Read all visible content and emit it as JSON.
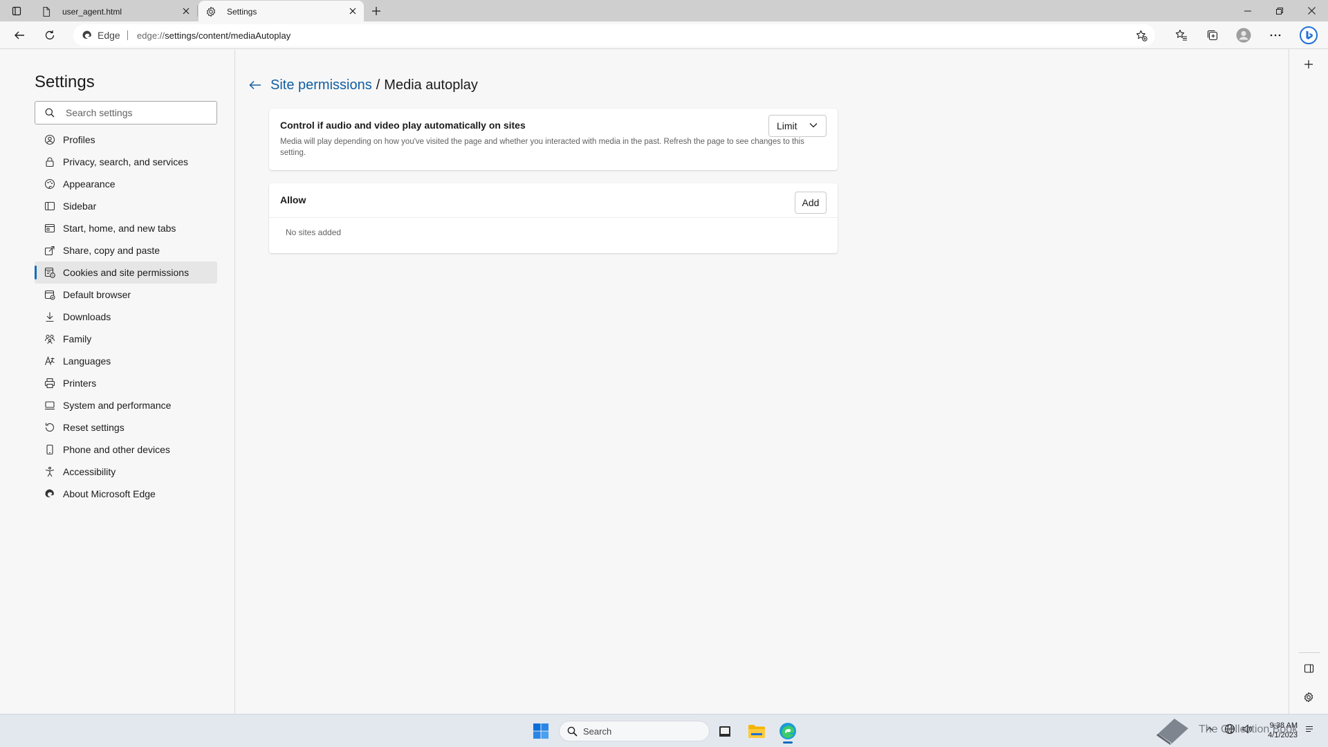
{
  "tabs": [
    {
      "title": "user_agent.html"
    },
    {
      "title": "Settings"
    }
  ],
  "address_bar": {
    "brand": "Edge",
    "url_prefix": "edge://",
    "url_path": "settings/content/mediaAutoplay"
  },
  "sidebar": {
    "title": "Settings",
    "search_placeholder": "Search settings",
    "items": [
      {
        "label": "Profiles",
        "icon": "profile-icon"
      },
      {
        "label": "Privacy, search, and services",
        "icon": "lock-icon"
      },
      {
        "label": "Appearance",
        "icon": "appearance-icon"
      },
      {
        "label": "Sidebar",
        "icon": "sidebar-icon"
      },
      {
        "label": "Start, home, and new tabs",
        "icon": "home-tabs-icon"
      },
      {
        "label": "Share, copy and paste",
        "icon": "share-icon"
      },
      {
        "label": "Cookies and site permissions",
        "icon": "cookies-icon",
        "active": true
      },
      {
        "label": "Default browser",
        "icon": "default-browser-icon"
      },
      {
        "label": "Downloads",
        "icon": "download-icon"
      },
      {
        "label": "Family",
        "icon": "family-icon"
      },
      {
        "label": "Languages",
        "icon": "languages-icon"
      },
      {
        "label": "Printers",
        "icon": "printer-icon"
      },
      {
        "label": "System and performance",
        "icon": "system-icon"
      },
      {
        "label": "Reset settings",
        "icon": "reset-icon"
      },
      {
        "label": "Phone and other devices",
        "icon": "phone-icon"
      },
      {
        "label": "Accessibility",
        "icon": "accessibility-icon"
      },
      {
        "label": "About Microsoft Edge",
        "icon": "edge-logo-icon"
      }
    ]
  },
  "breadcrumb": {
    "parent": "Site permissions",
    "separator": "/",
    "current": "Media autoplay"
  },
  "autoplay_card": {
    "heading": "Control if audio and video play automatically on sites",
    "description": "Media will play depending on how you've visited the page and whether you interacted with media in the past. Refresh the page to see changes to this setting.",
    "dropdown_value": "Limit"
  },
  "allow_card": {
    "heading": "Allow",
    "add_label": "Add",
    "empty_text": "No sites added"
  },
  "taskbar": {
    "search_label": "Search",
    "watermark_text": "The Collection Book",
    "time": "9:38 AM",
    "date": "4/1/2023"
  },
  "colors": {
    "accent": "#0f6cbd",
    "link": "#115ea3",
    "background": "#f7f7f7",
    "card": "#ffffff",
    "tab_strip": "#cfcfcf"
  }
}
